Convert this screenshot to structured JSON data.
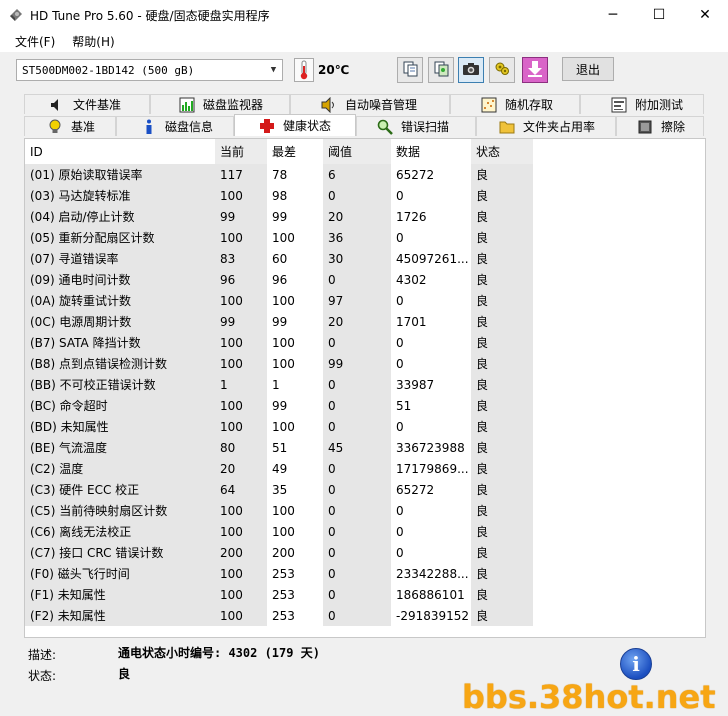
{
  "window": {
    "title": "HD Tune Pro 5.60 - 硬盘/固态硬盘实用程序",
    "minimize": "─",
    "maximize": "☐",
    "close": "✕"
  },
  "menu": [
    "文件(F)",
    "帮助(H)"
  ],
  "toolbar": {
    "drive": "ST500DM002-1BD142 (500 gB)",
    "temperature": "20℃",
    "exit_label": "退出"
  },
  "tabs_top": [
    "文件基准",
    "磁盘监视器",
    "自动噪音管理",
    "随机存取",
    "附加测试"
  ],
  "tabs_bottom": [
    "基准",
    "磁盘信息",
    "健康状态",
    "错误扫描",
    "文件夹占用率",
    "擦除"
  ],
  "active_tab": "健康状态",
  "table": {
    "headers": [
      "ID",
      "当前",
      "最差",
      "阈值",
      "数据",
      "状态"
    ],
    "rows": [
      [
        "(01) 原始读取错误率",
        "117",
        "78",
        "6",
        "65272",
        "良"
      ],
      [
        "(03) 马达旋转标准",
        "100",
        "98",
        "0",
        "0",
        "良"
      ],
      [
        "(04) 启动/停止计数",
        "99",
        "99",
        "20",
        "1726",
        "良"
      ],
      [
        "(05) 重新分配扇区计数",
        "100",
        "100",
        "36",
        "0",
        "良"
      ],
      [
        "(07) 寻道错误率",
        "83",
        "60",
        "30",
        "45097261...",
        "良"
      ],
      [
        "(09) 通电时间计数",
        "96",
        "96",
        "0",
        "4302",
        "良"
      ],
      [
        "(0A) 旋转重试计数",
        "100",
        "100",
        "97",
        "0",
        "良"
      ],
      [
        "(0C) 电源周期计数",
        "99",
        "99",
        "20",
        "1701",
        "良"
      ],
      [
        "(B7) SATA 降挡计数",
        "100",
        "100",
        "0",
        "0",
        "良"
      ],
      [
        "(B8) 点到点错误检测计数",
        "100",
        "100",
        "99",
        "0",
        "良"
      ],
      [
        "(BB) 不可校正错误计数",
        "1",
        "1",
        "0",
        "33987",
        "良"
      ],
      [
        "(BC) 命令超时",
        "100",
        "99",
        "0",
        "51",
        "良"
      ],
      [
        "(BD) 未知属性",
        "100",
        "100",
        "0",
        "0",
        "良"
      ],
      [
        "(BE) 气流温度",
        "80",
        "51",
        "45",
        "336723988",
        "良"
      ],
      [
        "(C2) 温度",
        "20",
        "49",
        "0",
        "17179869...",
        "良"
      ],
      [
        "(C3) 硬件 ECC 校正",
        "64",
        "35",
        "0",
        "65272",
        "良"
      ],
      [
        "(C5) 当前待映射扇区计数",
        "100",
        "100",
        "0",
        "0",
        "良"
      ],
      [
        "(C6) 离线无法校正",
        "100",
        "100",
        "0",
        "0",
        "良"
      ],
      [
        "(C7) 接口 CRC 错误计数",
        "200",
        "200",
        "0",
        "0",
        "良"
      ],
      [
        "(F0) 磁头飞行时间",
        "100",
        "253",
        "0",
        "23342288...",
        "良"
      ],
      [
        "(F1) 未知属性",
        "100",
        "253",
        "0",
        "186886101",
        "良"
      ],
      [
        "(F2) 未知属性",
        "100",
        "253",
        "0",
        "-291839152",
        "良"
      ]
    ]
  },
  "status": {
    "desc_label": "描述:",
    "desc_value": "通电状态小时编号: 4302 (179 天)",
    "state_label": "状态:",
    "state_value": "良"
  },
  "info_icon": "i",
  "watermark": "bbs.38hot.net",
  "colors": {
    "watermark": "#f7a614",
    "column_shade": "#e6e6e6",
    "info_icon": "#1c4fc0"
  }
}
